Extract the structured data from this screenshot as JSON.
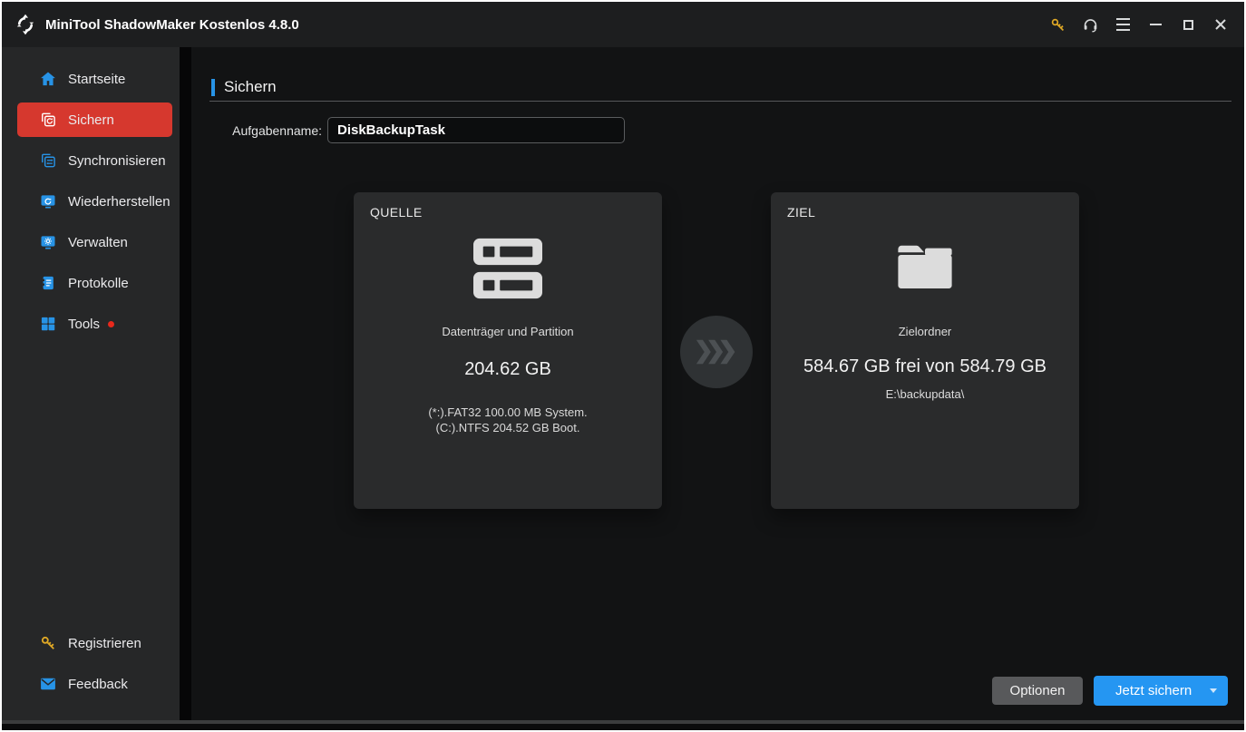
{
  "window": {
    "title": "MiniTool ShadowMaker Kostenlos 4.8.0"
  },
  "titlebar": {
    "icons": [
      "key-icon",
      "headset-icon",
      "menu-icon",
      "minimize-icon",
      "maximize-icon",
      "close-icon"
    ]
  },
  "sidebar": {
    "items": [
      {
        "label": "Startseite",
        "icon": "home-icon",
        "active": false
      },
      {
        "label": "Sichern",
        "icon": "backup-icon",
        "active": true
      },
      {
        "label": "Synchronisieren",
        "icon": "sync-icon",
        "active": false
      },
      {
        "label": "Wiederherstellen",
        "icon": "restore-icon",
        "active": false
      },
      {
        "label": "Verwalten",
        "icon": "manage-icon",
        "active": false
      },
      {
        "label": "Protokolle",
        "icon": "logs-icon",
        "active": false
      },
      {
        "label": "Tools",
        "icon": "tools-icon",
        "active": false,
        "badge": "red-dot"
      }
    ],
    "footer_items": [
      {
        "label": "Registrieren",
        "icon": "key-icon"
      },
      {
        "label": "Feedback",
        "icon": "mail-icon"
      }
    ]
  },
  "main": {
    "page_title": "Sichern",
    "task_name_label": "Aufgabenname:",
    "task_name_value": "DiskBackupTask",
    "source_card": {
      "title": "QUELLE",
      "icon": "disk-icon",
      "type_label": "Datenträger und Partition",
      "size": "204.62 GB",
      "details": [
        "(*:).FAT32 100.00 MB System.",
        "(C:).NTFS 204.52 GB Boot."
      ]
    },
    "target_card": {
      "title": "ZIEL",
      "icon": "folder-icon",
      "type_label": "Zielordner",
      "size": "584.67 GB frei von 584.79 GB",
      "path": "E:\\backupdata\\"
    },
    "buttons": {
      "options_label": "Optionen",
      "backup_now_label": "Jetzt sichern"
    }
  },
  "colors": {
    "accent_blue": "#2793e6",
    "button_blue": "#2596f2",
    "selected_red": "#d6382e",
    "badge_red": "#e8291c",
    "key_yellow": "#dfa825",
    "titlebar_bg": "#1d1e1f",
    "sidebar_bg": "#262728",
    "content_bg": "#121314",
    "card_bg": "#2a2b2c"
  }
}
